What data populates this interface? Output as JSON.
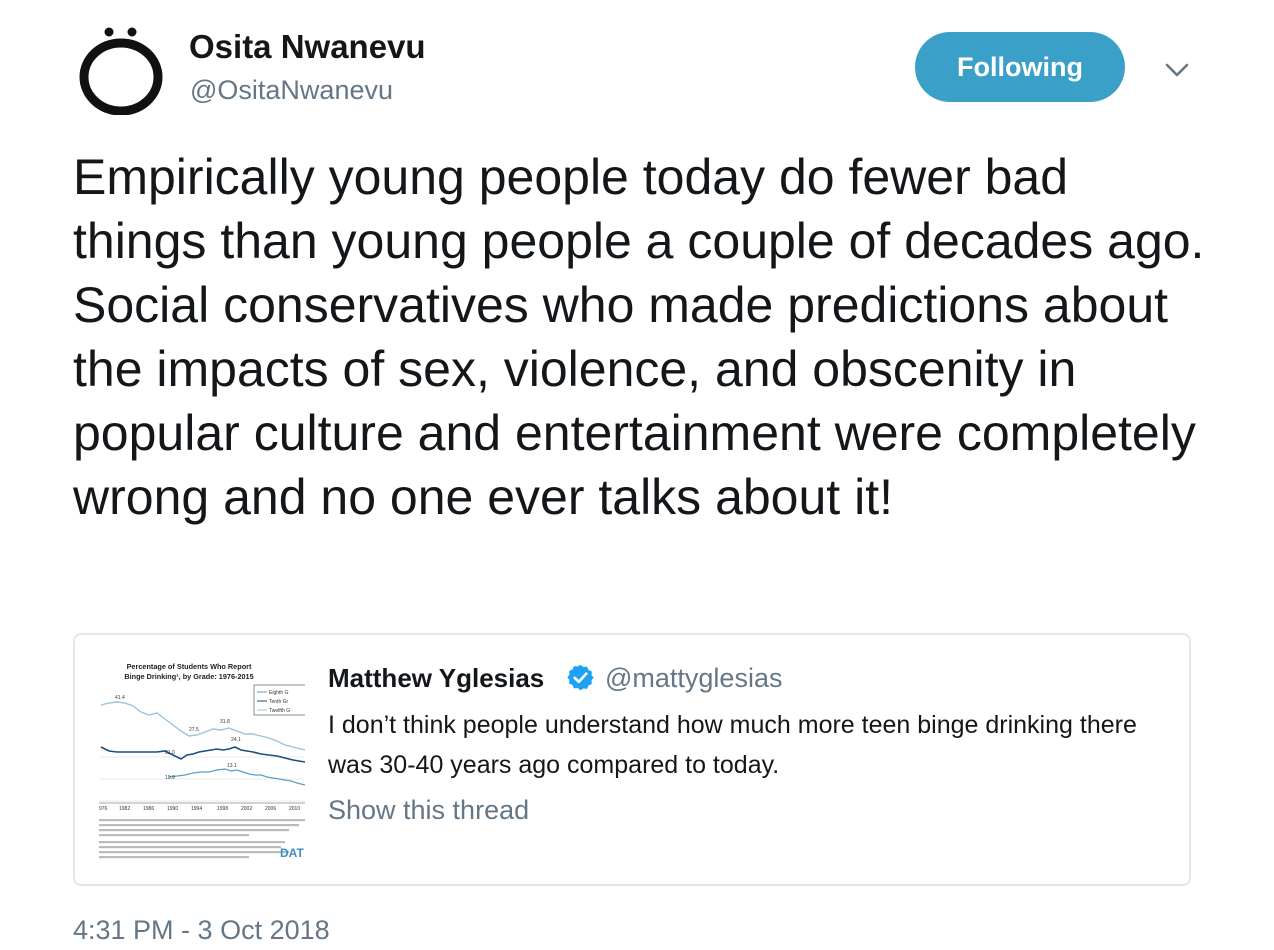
{
  "author": {
    "name": "Osita Nwanevu",
    "handle": "@OsitaNwanevu"
  },
  "follow_button": {
    "label": "Following"
  },
  "caret_icon": "chevron-down-icon",
  "tweet": {
    "text": "Empirically young people today do fewer bad things than young people a couple of decades ago. Social conservatives who made predictions about the impacts of sex, violence, and obscenity in popular culture and entertainment were completely wrong and no one ever talks about it!",
    "timestamp": "4:31 PM - 3 Oct 2018"
  },
  "quoted_tweet": {
    "name": "Matthew Yglesias",
    "handle": "@mattyglesias",
    "verified": true,
    "text": "I don’t think people understand how much more teen binge drinking there was 30-40 years ago compared to today.",
    "show_thread": "Show this thread",
    "thumbnail": {
      "title": "Percentage of Students Who Report Binge Drinking¹, by Grade: 1976-2015",
      "legend": [
        "Eighth G",
        "Tenth Gr",
        "Twelfth G"
      ],
      "x_labels": [
        "976",
        "1982",
        "1986",
        "1990",
        "1994",
        "1998",
        "2002",
        "2006",
        "2010"
      ],
      "value_labels": [
        "41.4",
        "31.8",
        "27.5",
        "24.1",
        "21.0",
        "13.1",
        "10.9"
      ],
      "logo_text": "DAT"
    }
  },
  "colors": {
    "follow_bg": "#3ba0c8",
    "secondary_text": "#657786",
    "verified": "#1da1f2",
    "border": "#e1e8ed"
  }
}
